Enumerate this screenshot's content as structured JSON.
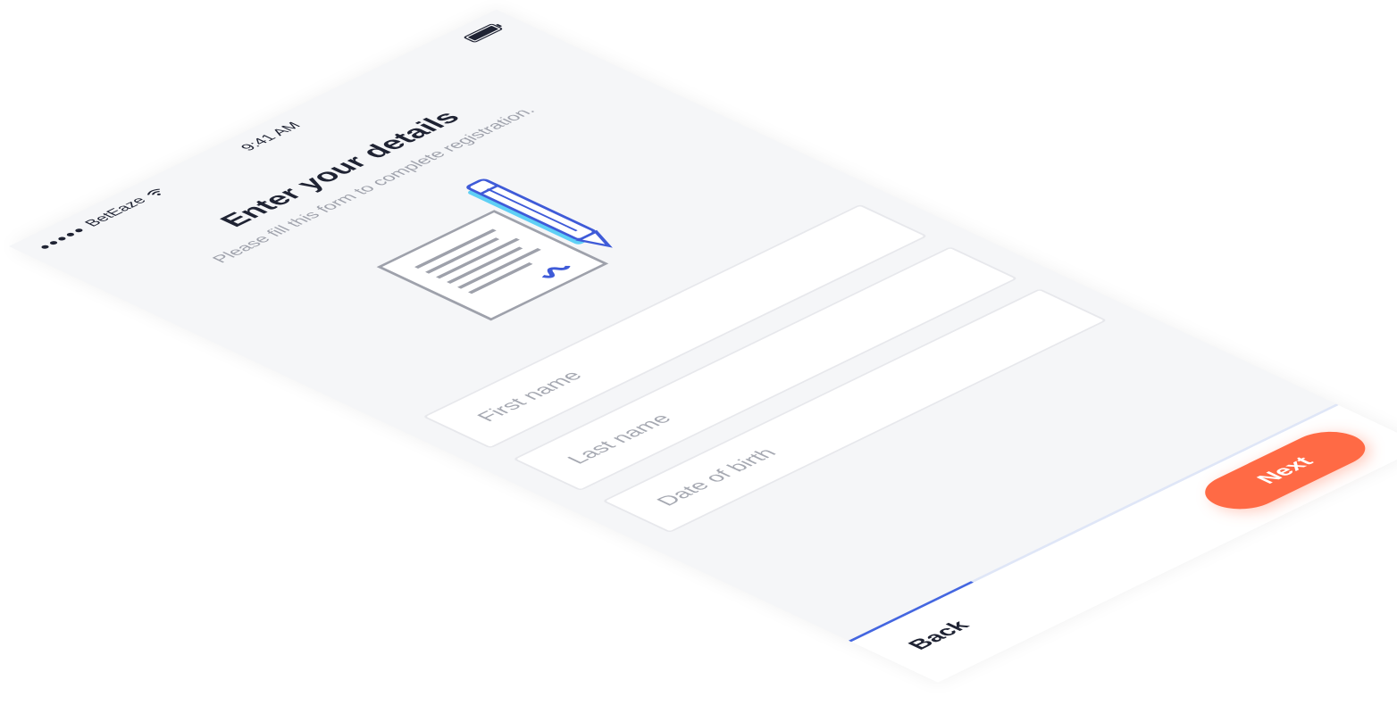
{
  "status_bar": {
    "signal_dots": "●●●●●",
    "carrier": "BetEaze",
    "time": "9:41 AM"
  },
  "header": {
    "title": "Enter your details",
    "subtitle": "Please fill this form to complete registration."
  },
  "form": {
    "fields": [
      {
        "placeholder": "First name",
        "value": ""
      },
      {
        "placeholder": "Last name",
        "value": ""
      },
      {
        "placeholder": "Date of birth",
        "value": ""
      }
    ]
  },
  "footer": {
    "back_label": "Back",
    "next_label": "Next",
    "progress_fraction": 0.25
  },
  "colors": {
    "accent": "#ff6a45",
    "progress": "#4466e0",
    "pencil": "#3f5bd8",
    "pencil_shadow": "#5fd0f5",
    "document": "#9ea1ab"
  }
}
